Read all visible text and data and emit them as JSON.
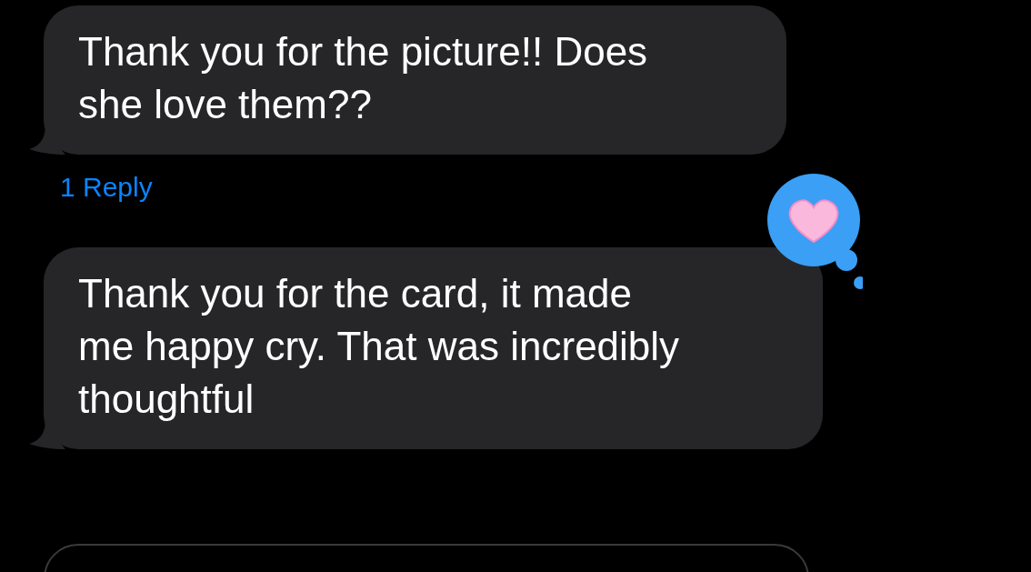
{
  "messages": [
    {
      "text": "Thank you for the picture!! Does\nshe love them??",
      "replies": "1 Reply"
    },
    {
      "text": "Thank you for the card, it made\nme happy cry. That was incredibly\nthoughtful",
      "reaction": {
        "kind": "heart"
      }
    }
  ]
}
